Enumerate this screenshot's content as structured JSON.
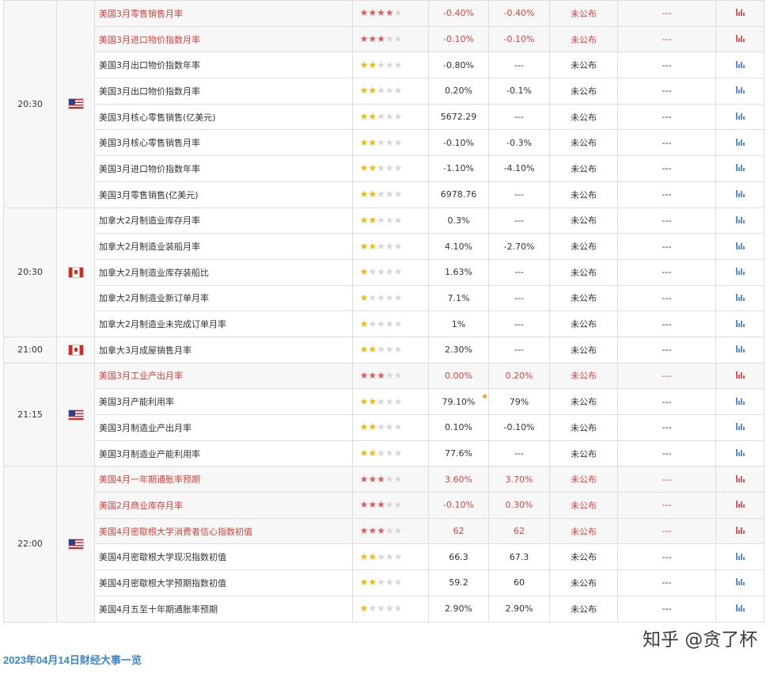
{
  "blocks": [
    {
      "time": "20:30",
      "country": "us",
      "rows": [
        {
          "name": "美国3月零售销售月率",
          "stars": 4,
          "prev": "-0.40%",
          "forecast": "-0.40%",
          "actual": "未公布",
          "extra": "---",
          "hl": true
        },
        {
          "name": "美国3月进口物价指数月率",
          "stars": 3,
          "prev": "-0.10%",
          "forecast": "-0.10%",
          "actual": "未公布",
          "extra": "---",
          "hl": true
        },
        {
          "name": "美国3月出口物价指数年率",
          "stars": 2,
          "prev": "-0.80%",
          "forecast": "---",
          "actual": "未公布",
          "extra": "---",
          "hl": false
        },
        {
          "name": "美国3月出口物价指数月率",
          "stars": 2,
          "prev": "0.20%",
          "forecast": "-0.1%",
          "actual": "未公布",
          "extra": "---",
          "hl": false
        },
        {
          "name": "美国3月核心零售销售(亿美元)",
          "stars": 2,
          "prev": "5672.29",
          "forecast": "---",
          "actual": "未公布",
          "extra": "---",
          "hl": false
        },
        {
          "name": "美国3月核心零售销售月率",
          "stars": 2,
          "prev": "-0.10%",
          "forecast": "-0.3%",
          "actual": "未公布",
          "extra": "---",
          "hl": false
        },
        {
          "name": "美国3月进口物价指数年率",
          "stars": 2,
          "prev": "-1.10%",
          "forecast": "-4.10%",
          "actual": "未公布",
          "extra": "---",
          "hl": false
        },
        {
          "name": "美国3月零售销售(亿美元)",
          "stars": 2,
          "prev": "6978.76",
          "forecast": "---",
          "actual": "未公布",
          "extra": "---",
          "hl": false
        }
      ]
    },
    {
      "time": "20:30",
      "country": "ca",
      "rows": [
        {
          "name": "加拿大2月制造业库存月率",
          "stars": 2,
          "prev": "0.3%",
          "forecast": "---",
          "actual": "未公布",
          "extra": "---",
          "hl": false
        },
        {
          "name": "加拿大2月制造业装船月率",
          "stars": 2,
          "prev": "4.10%",
          "forecast": "-2.70%",
          "actual": "未公布",
          "extra": "---",
          "hl": false
        },
        {
          "name": "加拿大2月制造业库存装船比",
          "stars": 1,
          "prev": "1.63%",
          "forecast": "---",
          "actual": "未公布",
          "extra": "---",
          "hl": false
        },
        {
          "name": "加拿大2月制造业新订单月率",
          "stars": 1,
          "prev": "7.1%",
          "forecast": "---",
          "actual": "未公布",
          "extra": "---",
          "hl": false
        },
        {
          "name": "加拿大2月制造业未完成订单月率",
          "stars": 1,
          "prev": "1%",
          "forecast": "---",
          "actual": "未公布",
          "extra": "---",
          "hl": false
        }
      ]
    },
    {
      "time": "21:00",
      "country": "ca",
      "rows": [
        {
          "name": "加拿大3月成屋销售月率",
          "stars": 2,
          "prev": "2.30%",
          "forecast": "---",
          "actual": "未公布",
          "extra": "---",
          "hl": false
        }
      ]
    },
    {
      "time": "21:15",
      "country": "us",
      "rows": [
        {
          "name": "美国3月工业产出月率",
          "stars": 3,
          "prev": "0.00%",
          "forecast": "0.20%",
          "actual": "未公布",
          "extra": "---",
          "hl": true
        },
        {
          "name": "美国3月产能利用率",
          "stars": 2,
          "prev": "79.10%",
          "forecast": "79%",
          "actual": "未公布",
          "extra": "---",
          "hl": false,
          "dot": true
        },
        {
          "name": "美国3月制造业产出月率",
          "stars": 2,
          "prev": "0.10%",
          "forecast": "-0.10%",
          "actual": "未公布",
          "extra": "---",
          "hl": false
        },
        {
          "name": "美国3月制造业产能利用率",
          "stars": 2,
          "prev": "77.6%",
          "forecast": "---",
          "actual": "未公布",
          "extra": "---",
          "hl": false
        }
      ]
    },
    {
      "time": "22:00",
      "country": "us",
      "rows": [
        {
          "name": "美国4月一年期通胀率预期",
          "stars": 3,
          "prev": "3.60%",
          "forecast": "3.70%",
          "actual": "未公布",
          "extra": "---",
          "hl": true
        },
        {
          "name": "美国2月商业库存月率",
          "stars": 3,
          "prev": "-0.10%",
          "forecast": "0.30%",
          "actual": "未公布",
          "extra": "---",
          "hl": true
        },
        {
          "name": "美国4月密歇根大学消费者信心指数初值",
          "stars": 3,
          "prev": "62",
          "forecast": "62",
          "actual": "未公布",
          "extra": "---",
          "hl": true
        },
        {
          "name": "美国4月密歇根大学现况指数初值",
          "stars": 2,
          "prev": "66.3",
          "forecast": "67.3",
          "actual": "未公布",
          "extra": "---",
          "hl": false
        },
        {
          "name": "美国4月密歇根大学预期指数初值",
          "stars": 2,
          "prev": "59.2",
          "forecast": "60",
          "actual": "未公布",
          "extra": "---",
          "hl": false
        },
        {
          "name": "美国4月五至十年期通胀率预期",
          "stars": 1,
          "prev": "2.90%",
          "forecast": "2.90%",
          "actual": "未公布",
          "extra": "---",
          "hl": false
        }
      ]
    }
  ],
  "footer_link": "2023年04月14日财经大事一览",
  "watermark": "知乎 @贪了杯",
  "icons": {
    "flag_us": "us-flag-icon",
    "flag_ca": "canada-flag-icon",
    "chart": "bar-chart-icon",
    "star": "star-icon"
  },
  "colors": {
    "highlight_text": "#d9433b",
    "link": "#3b86cc",
    "star_gold": "#f2b807",
    "star_red": "#e05a5a",
    "chart_blue": "#5b8ed6"
  }
}
